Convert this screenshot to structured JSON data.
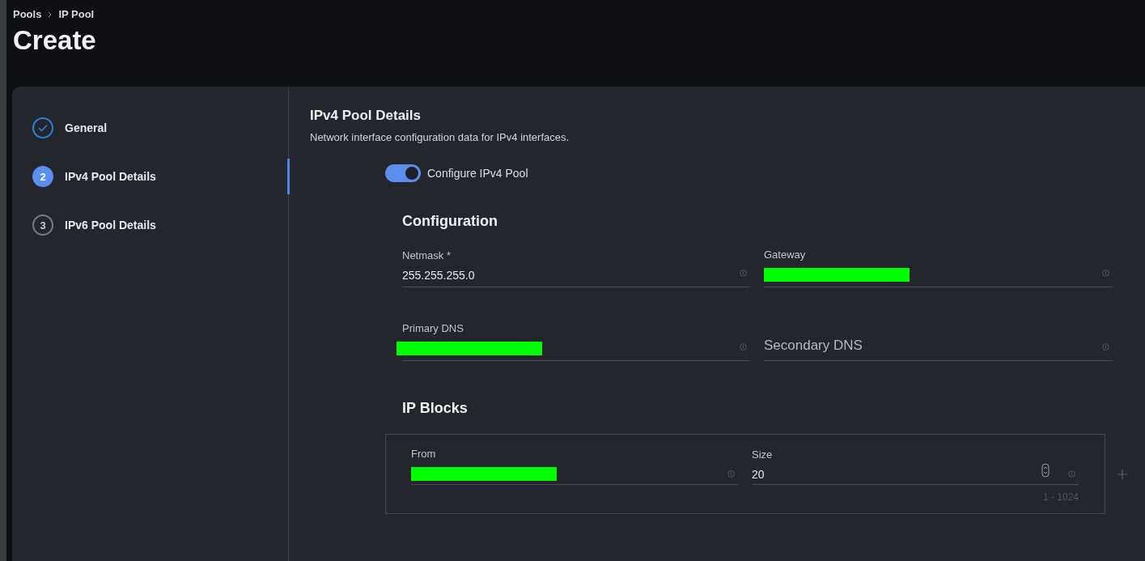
{
  "breadcrumb": [
    "Pools",
    "IP Pool"
  ],
  "title": "Create",
  "steps": [
    {
      "label": "General",
      "completed": true,
      "selected": false
    },
    {
      "label": "IPv4 Pool Details",
      "marker": "2",
      "completed": false,
      "selected": true
    },
    {
      "label": "IPv6 Pool Details",
      "marker": "3",
      "completed": false,
      "selected": false
    }
  ],
  "section": {
    "title": "IPv4 Pool Details",
    "description": "Network interface configuration data for IPv4 interfaces."
  },
  "toggle": {
    "label": "Configure IPv4 Pool",
    "on": true
  },
  "configuration": {
    "title": "Configuration",
    "fields": [
      {
        "label": "Netmask *",
        "value": "255.255.255.0",
        "redacted": false
      },
      {
        "label": "Gateway",
        "redacted": true
      },
      {
        "label": "Primary DNS",
        "redacted": true
      },
      {
        "placeholder": "Secondary DNS",
        "redacted": false
      }
    ]
  },
  "ip_blocks": {
    "title": "IP Blocks",
    "from": {
      "label": "From",
      "redacted": true
    },
    "size": {
      "label": "Size",
      "value": "20",
      "hint": "1 - 1024"
    }
  }
}
